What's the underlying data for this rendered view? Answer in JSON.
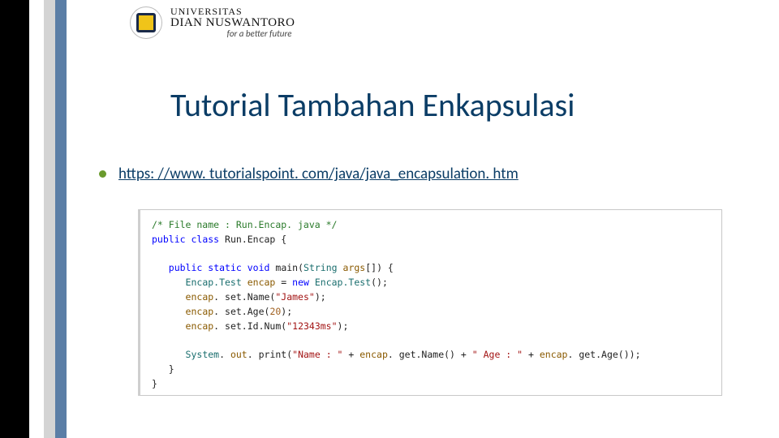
{
  "logo": {
    "line1": "UNIVERSITAS",
    "line2": "DIAN NUSWANTORO",
    "tagline": "for a better future"
  },
  "title": "Tutorial Tambahan Enkapsulasi",
  "link": {
    "text": "https: //www. tutorialspoint. com/java/java_encapsulation. htm"
  },
  "code": {
    "comment": "/* File name : Run.Encap. java */",
    "kw_public": "public",
    "kw_class": "class",
    "cls_run": "Run.Encap",
    "kw_static": "static",
    "kw_void": "void",
    "kw_new": "new",
    "mtd_main": "main",
    "cls_string": "String",
    "var_args": "args",
    "cls_encap": "Encap.Test",
    "var_encap": "encap",
    "m_setName": "set.Name",
    "m_setAge": "set.Age",
    "m_setId": "set.Id.Num",
    "m_getName": "get.Name",
    "m_getAge": "get.Age",
    "str_james": "\"James\"",
    "num_20": "20",
    "str_id": "\"12343ms\"",
    "cls_system": "System",
    "var_out": "out",
    "m_print": "print",
    "str_name": "\"Name : \"",
    "str_age": "\" Age : \""
  }
}
